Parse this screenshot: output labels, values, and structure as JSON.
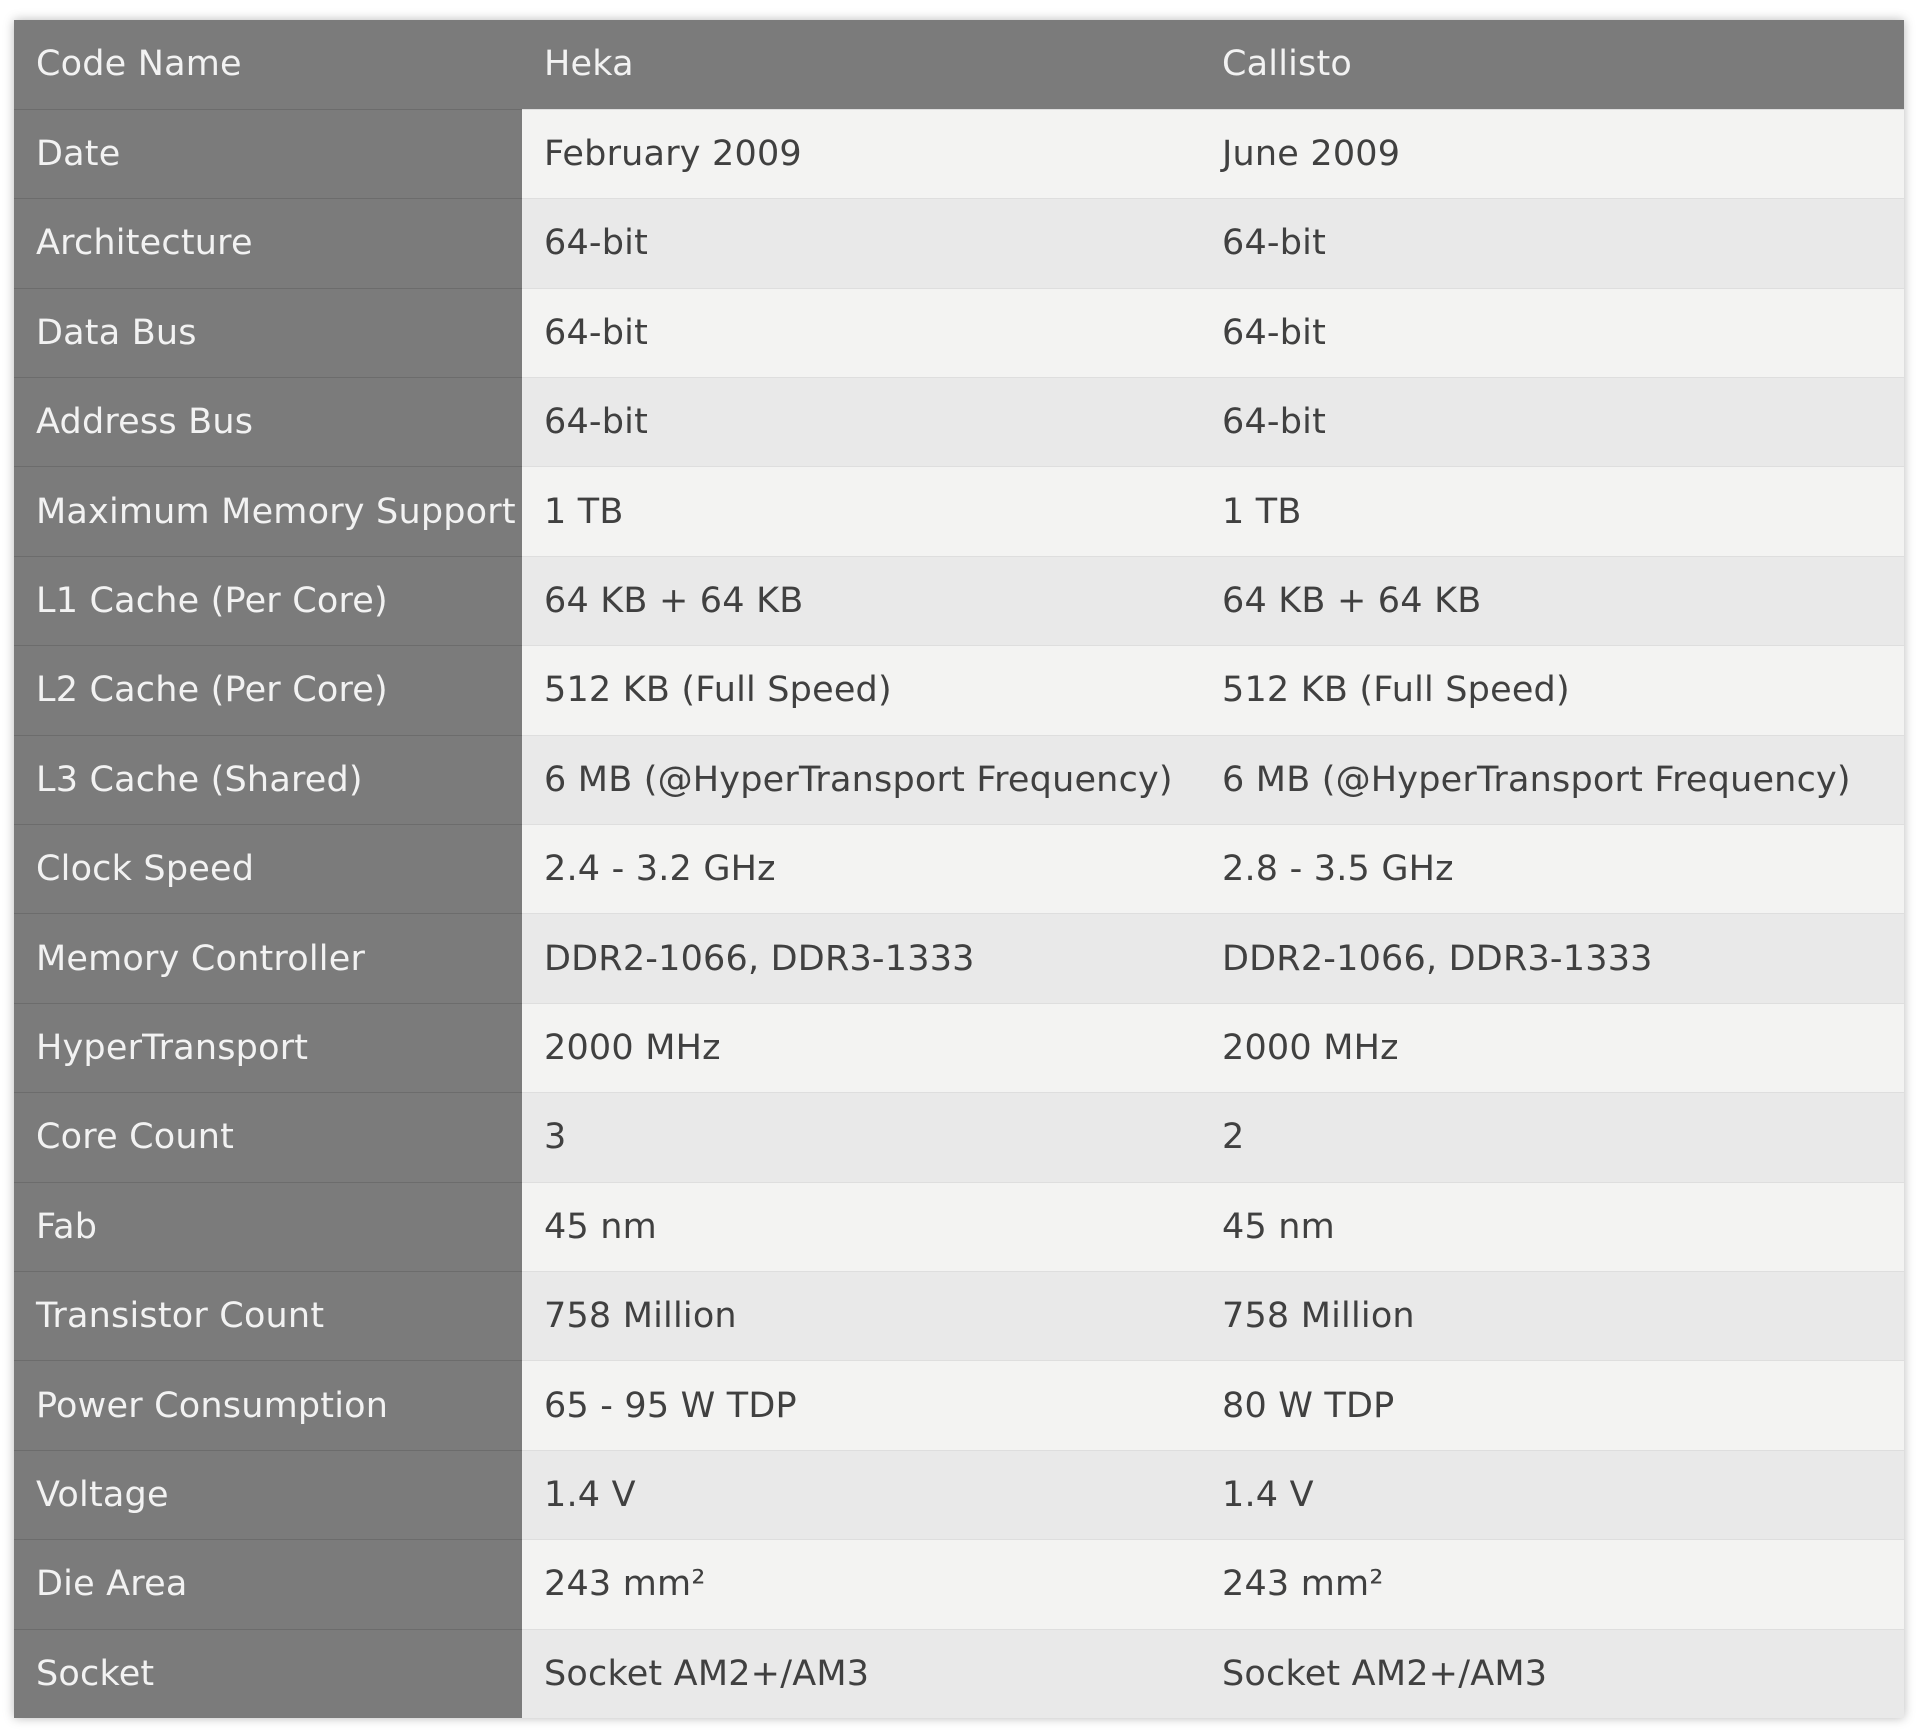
{
  "header": {
    "label": "Code Name",
    "col1": "Heka",
    "col2": "Callisto"
  },
  "rows": [
    {
      "label": "Date",
      "heka": "February 2009",
      "callisto": "June 2009"
    },
    {
      "label": "Architecture",
      "heka": "64-bit",
      "callisto": "64-bit"
    },
    {
      "label": "Data Bus",
      "heka": "64-bit",
      "callisto": "64-bit"
    },
    {
      "label": "Address Bus",
      "heka": "64-bit",
      "callisto": "64-bit"
    },
    {
      "label": "Maximum Memory Support",
      "heka": "1 TB",
      "callisto": "1 TB"
    },
    {
      "label": "L1 Cache (Per Core)",
      "heka": "64 KB + 64 KB",
      "callisto": "64 KB + 64 KB"
    },
    {
      "label": "L2 Cache (Per Core)",
      "heka": "512 KB (Full Speed)",
      "callisto": "512 KB (Full Speed)"
    },
    {
      "label": "L3 Cache (Shared)",
      "heka": "6 MB (@HyperTransport Frequency)",
      "callisto": "6 MB (@HyperTransport Frequency)"
    },
    {
      "label": "Clock Speed",
      "heka": "2.4 - 3.2 GHz",
      "callisto": "2.8 - 3.5 GHz"
    },
    {
      "label": "Memory Controller",
      "heka": "DDR2-1066, DDR3-1333",
      "callisto": "DDR2-1066, DDR3-1333"
    },
    {
      "label": "HyperTransport",
      "heka": "2000 MHz",
      "callisto": "2000 MHz"
    },
    {
      "label": "Core Count",
      "heka": "3",
      "callisto": "2"
    },
    {
      "label": "Fab",
      "heka": "45 nm",
      "callisto": "45 nm"
    },
    {
      "label": "Transistor Count",
      "heka": "758 Million",
      "callisto": "758 Million"
    },
    {
      "label": "Power Consumption",
      "heka": "65 - 95 W TDP",
      "callisto": "80 W TDP"
    },
    {
      "label": "Voltage",
      "heka": "1.4 V",
      "callisto": "1.4 V"
    },
    {
      "label": "Die Area",
      "heka": "243 mm²",
      "callisto": "243 mm²"
    },
    {
      "label": "Socket",
      "heka": "Socket AM2+/AM3",
      "callisto": "Socket AM2+/AM3"
    }
  ]
}
